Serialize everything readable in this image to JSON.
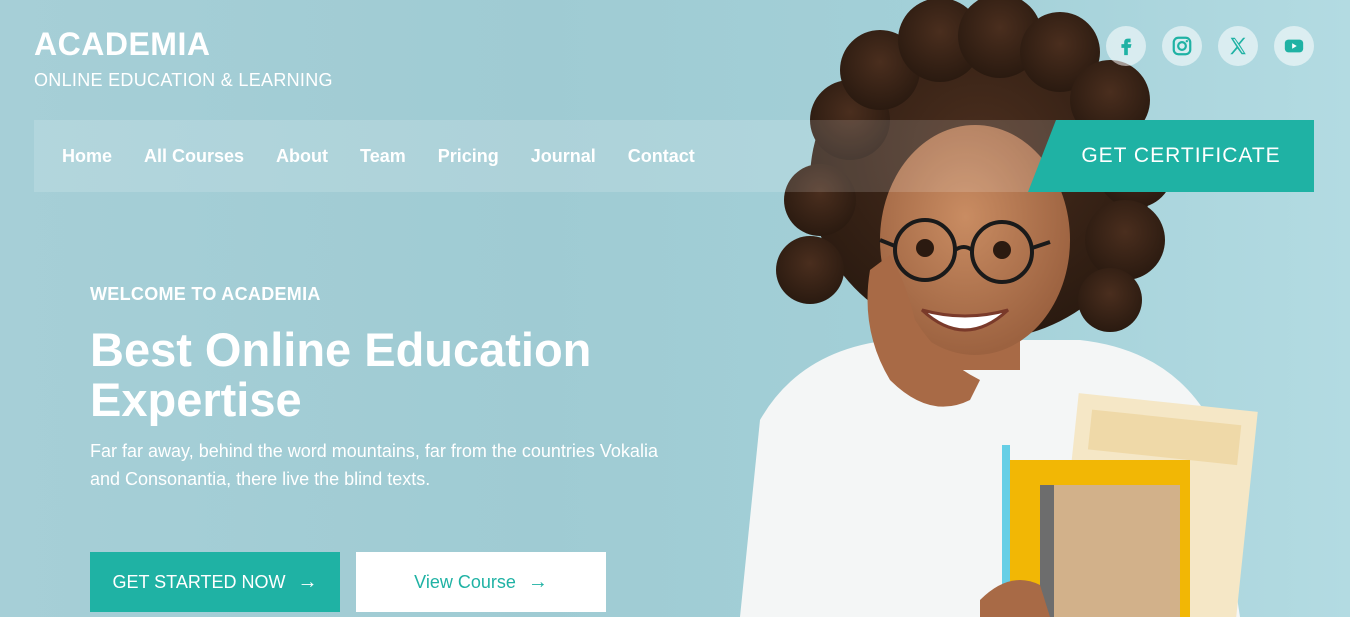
{
  "brand": {
    "title": "ACADEMIA",
    "subtitle": "ONLINE EDUCATION & LEARNING"
  },
  "social": [
    {
      "icon": "facebook-icon"
    },
    {
      "icon": "instagram-icon"
    },
    {
      "icon": "x-icon"
    },
    {
      "icon": "youtube-icon"
    }
  ],
  "nav": {
    "items": [
      "Home",
      "All Courses",
      "About",
      "Team",
      "Pricing",
      "Journal",
      "Contact"
    ],
    "cta": "GET CERTIFICATE"
  },
  "hero": {
    "eyebrow": "WELCOME TO ACADEMIA",
    "headline": "Best Online Education Expertise",
    "description": "Far far away, behind the word mountains, far from the countries Vokalia and Consonantia, there live the blind texts.",
    "primary_button": "GET STARTED NOW",
    "secondary_button": "View Course"
  },
  "colors": {
    "accent": "#1fb2a4",
    "background": "#a6cfd7",
    "text": "#ffffff"
  }
}
